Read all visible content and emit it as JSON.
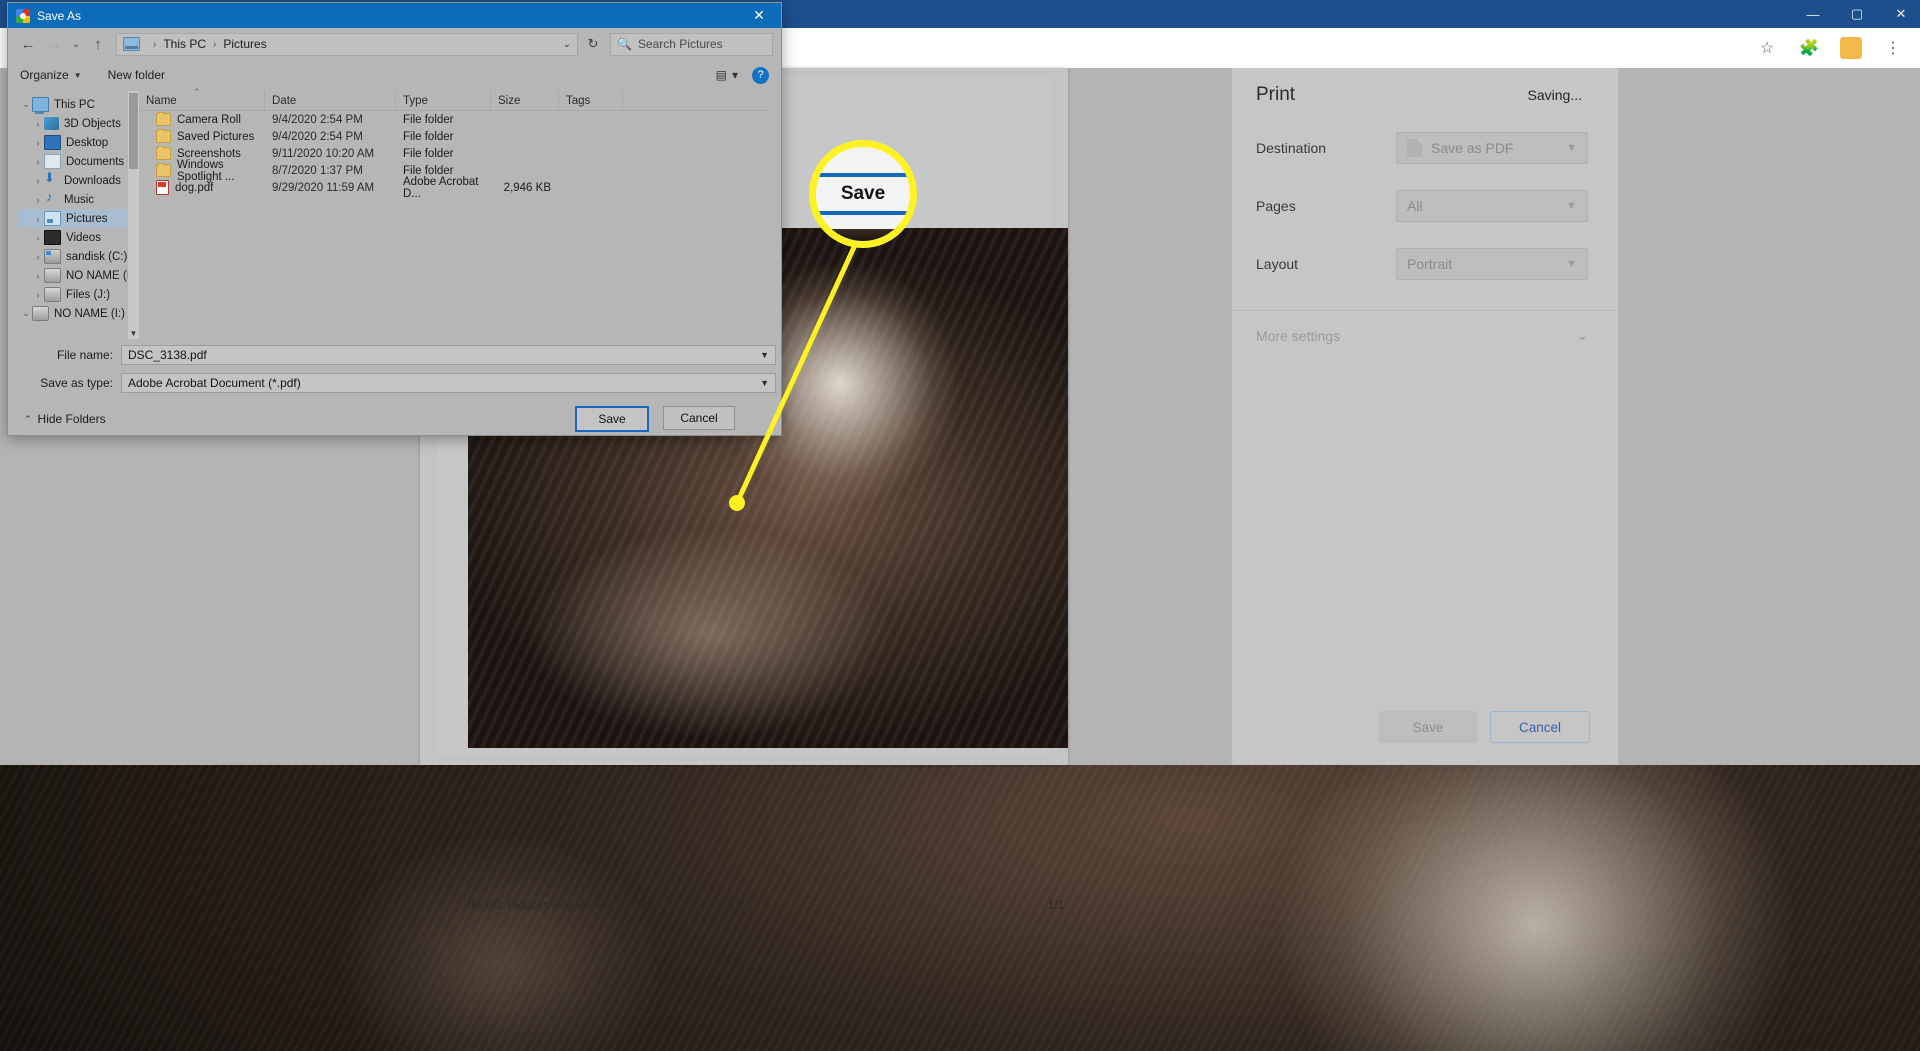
{
  "browser": {
    "window_controls": [
      "minimize",
      "maximize",
      "close"
    ],
    "toolbar_icons": [
      "star-icon",
      "extensions-icon",
      "profile-avatar",
      "more-menu-icon"
    ],
    "avatar_initial": ""
  },
  "print_preview": {
    "footer_url": "file:///J:/Pictures/Dog Photos/Amber Pics/DSC_3138.jpg",
    "page_indicator": "1/1"
  },
  "print_panel": {
    "title": "Print",
    "status": "Saving...",
    "settings": [
      {
        "label": "Destination",
        "value": "Save as PDF",
        "has_doc_icon": true
      },
      {
        "label": "Pages",
        "value": "All",
        "has_doc_icon": false
      },
      {
        "label": "Layout",
        "value": "Portrait",
        "has_doc_icon": false
      }
    ],
    "more_settings_label": "More settings",
    "save_label": "Save",
    "cancel_label": "Cancel"
  },
  "dialog": {
    "title": "Save As",
    "close_label": "✕",
    "nav": {
      "back": "←",
      "forward": "→",
      "recent": "⌄",
      "up": "↑",
      "breadcrumb": [
        "This PC",
        "Pictures"
      ],
      "breadcrumb_caret": "⌄",
      "refresh": "↻",
      "search_placeholder": "Search Pictures"
    },
    "commandbar": {
      "organize": "Organize",
      "new_folder": "New folder",
      "view_caret": "▾",
      "help": "?"
    },
    "tree": [
      {
        "label": "This PC",
        "level": 0,
        "expander": "⌄",
        "icon": "ti-pc",
        "selected": false
      },
      {
        "label": "3D Objects",
        "level": 1,
        "expander": "›",
        "icon": "ti-3d",
        "selected": false
      },
      {
        "label": "Desktop",
        "level": 1,
        "expander": "›",
        "icon": "ti-desk",
        "selected": false
      },
      {
        "label": "Documents",
        "level": 1,
        "expander": "›",
        "icon": "ti-doc",
        "selected": false
      },
      {
        "label": "Downloads",
        "level": 1,
        "expander": "›",
        "icon": "ti-dl",
        "selected": false
      },
      {
        "label": "Music",
        "level": 1,
        "expander": "›",
        "icon": "ti-mus",
        "selected": false
      },
      {
        "label": "Pictures",
        "level": 1,
        "expander": "›",
        "icon": "ti-pic",
        "selected": true
      },
      {
        "label": "Videos",
        "level": 1,
        "expander": "›",
        "icon": "ti-vid",
        "selected": false
      },
      {
        "label": "sandisk (C:)",
        "level": 1,
        "expander": "›",
        "icon": "ti-drvc",
        "selected": false
      },
      {
        "label": "NO NAME (I:)",
        "level": 1,
        "expander": "›",
        "icon": "ti-drv",
        "selected": false
      },
      {
        "label": "Files (J:)",
        "level": 1,
        "expander": "›",
        "icon": "ti-drv",
        "selected": false
      },
      {
        "label": "NO NAME (I:)",
        "level": 0,
        "expander": "⌄",
        "icon": "ti-drv",
        "selected": false
      }
    ],
    "columns": [
      "Name",
      "Date",
      "Type",
      "Size",
      "Tags"
    ],
    "files": [
      {
        "name": "Camera Roll",
        "date": "9/4/2020 2:54 PM",
        "type": "File folder",
        "size": "",
        "icon": "folder"
      },
      {
        "name": "Saved Pictures",
        "date": "9/4/2020 2:54 PM",
        "type": "File folder",
        "size": "",
        "icon": "folder"
      },
      {
        "name": "Screenshots",
        "date": "9/11/2020 10:20 AM",
        "type": "File folder",
        "size": "",
        "icon": "folder"
      },
      {
        "name": "Windows Spotlight ...",
        "date": "8/7/2020 1:37 PM",
        "type": "File folder",
        "size": "",
        "icon": "folder"
      },
      {
        "name": "dog.pdf",
        "date": "9/29/2020 11:59 AM",
        "type": "Adobe Acrobat D...",
        "size": "2,946 KB",
        "icon": "pdf"
      }
    ],
    "fields": [
      {
        "label": "File name:",
        "value": "DSC_3138.pdf"
      },
      {
        "label": "Save as type:",
        "value": "Adobe Acrobat Document (*.pdf)"
      }
    ],
    "hide_folders": "Hide Folders",
    "save_button": "Save",
    "cancel_button": "Cancel"
  },
  "callout": {
    "magnified_label": "Save",
    "highlight_color": "#fff223"
  }
}
